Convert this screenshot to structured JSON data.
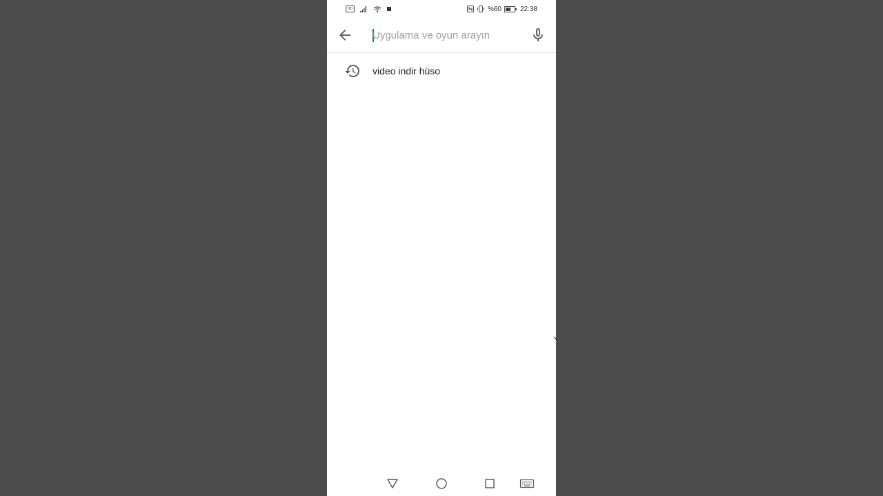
{
  "statusbar": {
    "left_icons": [
      "hd-badge-icon",
      "signal-icon",
      "wifi-icon",
      "notification-square-icon"
    ],
    "hd_label": "HD",
    "right_icons": [
      "nfc-icon",
      "vibrate-icon",
      "battery-icon"
    ],
    "battery_text": "%60",
    "battery_level": 0.6,
    "time": "22:38"
  },
  "search": {
    "value": "",
    "placeholder": "Uygulama ve oyun arayın",
    "back_icon": "arrow-left-icon",
    "mic_icon": "microphone-icon"
  },
  "history": {
    "items": [
      {
        "label": "video indir hüso",
        "icon": "history-icon"
      }
    ]
  },
  "navbar": {
    "buttons": [
      "triangle-back-icon",
      "circle-home-icon",
      "square-recent-icon",
      "keyboard-icon"
    ]
  },
  "colors": {
    "background": "#4c4c4c",
    "screen": "#ffffff",
    "accent": "#01875f",
    "icon": "#5f6368",
    "placeholder": "#9e9e9e"
  }
}
